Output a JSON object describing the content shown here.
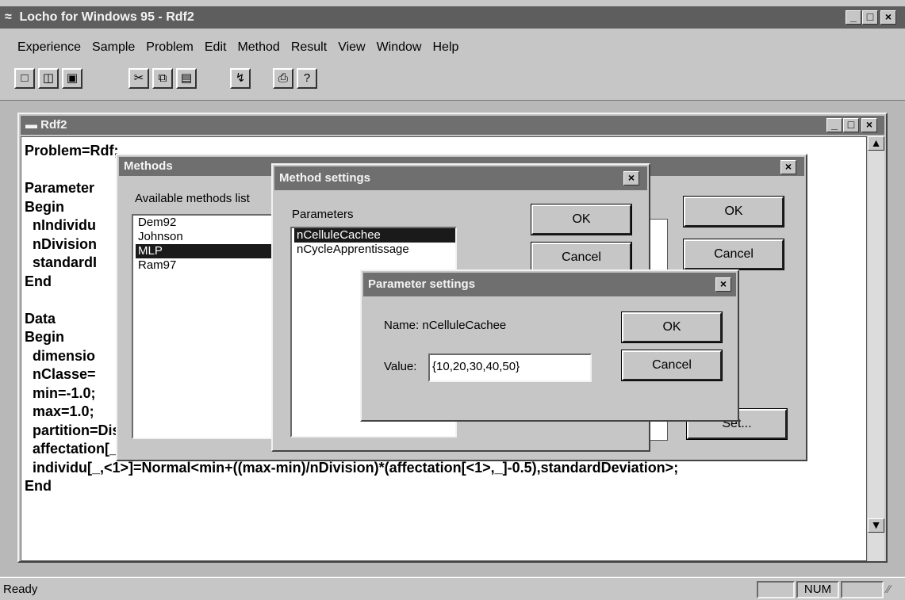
{
  "app": {
    "title": "Locho for Windows 95 - Rdf2"
  },
  "menu": [
    "Experience",
    "Sample",
    "Problem",
    "Edit",
    "Method",
    "Result",
    "View",
    "Window",
    "Help"
  ],
  "toolbar_icons": [
    "new-icon",
    "open-icon",
    "save-icon",
    "cut-icon",
    "copy-icon",
    "paste-icon",
    "run-icon",
    "print-icon",
    "help-icon"
  ],
  "document": {
    "title": "Rdf2",
    "lines": [
      "Problem=Rdf;",
      "",
      "Parameter",
      "Begin",
      "  nIndividu",
      "  nDivision",
      "  standardI",
      "End",
      "",
      "Data",
      "Begin",
      "  dimensio",
      "  nClasse=",
      "  min=-1.0;",
      "  max=1.0;",
      "  partition=Discret<<0.2,0>,<0.1,1>,<0.6,2>,<0.1,3>>;",
      "  affectation[_,<1>]=Uniforme<1,nDivision,partition[<1>]<>0>;",
      "  individu[_,<1>]=Normal<min+((max-min)/nDivision)*(affectation[<1>,_]-0.5),standardDeviation>;",
      "End"
    ]
  },
  "methods_dialog": {
    "title": "Methods",
    "list_label": "Available methods list",
    "methods": [
      "Dem92",
      "Johnson",
      "MLP",
      "Ram97"
    ],
    "selected": "MLP",
    "ok": "OK",
    "cancel": "Cancel",
    "set": "Set..."
  },
  "method_settings": {
    "title": "Method settings",
    "params_label": "Parameters",
    "params": [
      "nCelluleCachee",
      "nCycleApprentissage"
    ],
    "selected": "nCelluleCachee",
    "ok": "OK",
    "cancel": "Cancel"
  },
  "param_settings": {
    "title": "Parameter settings",
    "name_text": "Name: nCelluleCachee",
    "value_label": "Value:",
    "value": "{10,20,30,40,50}",
    "ok": "OK",
    "cancel": "Cancel"
  },
  "status": {
    "text": "Ready",
    "num": "NUM"
  }
}
